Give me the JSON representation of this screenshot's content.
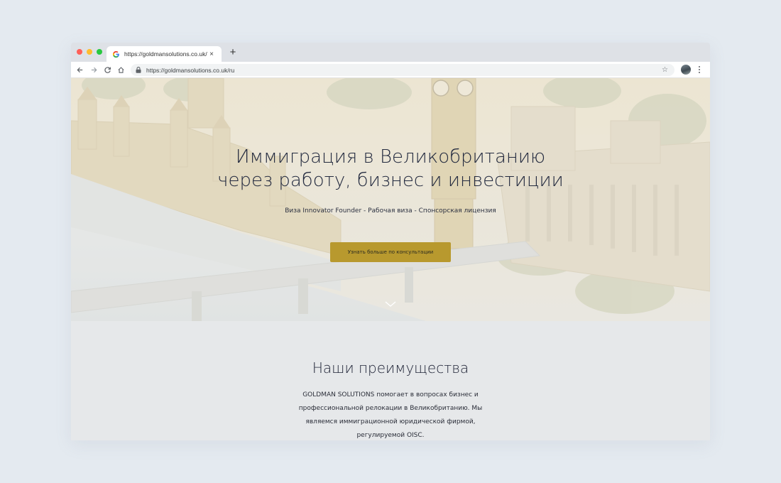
{
  "browser": {
    "tab_title": "https://goldmansolutions.co.uk/ru",
    "tab_close": "×",
    "new_tab": "+",
    "url": "https://goldmansolutions.co.uk/ru",
    "star": "☆",
    "traffic_colors": [
      "#ff5f57",
      "#febc2e",
      "#28c840"
    ]
  },
  "hero": {
    "title_line1": "Иммиграция в Великобританию",
    "title_line2": "через работу, бизнес и инвестиции",
    "subtitle": "Виза Innovator Founder - Рабочая виза - Спонсорская лицензия",
    "cta_label": "Узнать больше по консультации",
    "accent_color": "#b8992e"
  },
  "advantages": {
    "title": "Наши преимущества",
    "line1": "GOLDMAN SOLUTIONS помогает в вопросах бизнес и",
    "line2": "профессиональной релокации в Великобританию. Мы",
    "line3": "являемся иммиграционной юридической фирмой,",
    "line4": "регулируемой OISC."
  },
  "icons": [
    "google-icon",
    "back-arrow-icon",
    "forward-arrow-icon",
    "reload-icon",
    "home-icon",
    "lock-icon",
    "star-icon",
    "more-vertical-icon",
    "chevron-down-icon"
  ]
}
